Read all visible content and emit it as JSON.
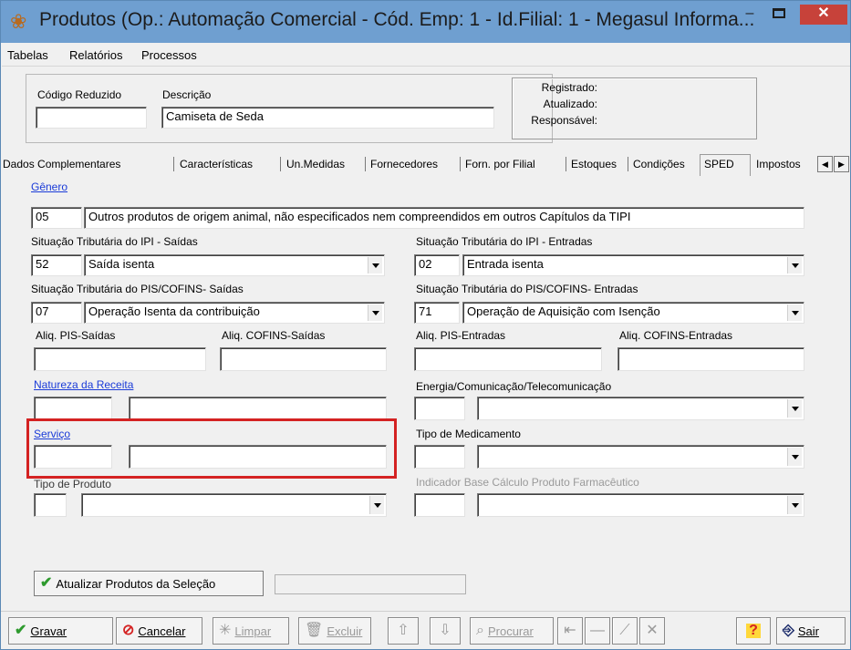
{
  "window": {
    "title": "Produtos (Op.: Automação Comercial - Cód. Emp: 1 - Id.Filial: 1 - Megasul Informa...",
    "minimize": "–",
    "close": "✕"
  },
  "menu": [
    "Tabelas",
    "Relatórios",
    "Processos"
  ],
  "header": {
    "codigo_label": "Código Reduzido",
    "codigo_value": "",
    "descricao_label": "Descrição",
    "descricao_value": "Camiseta de Seda",
    "registrado": "Registrado:",
    "atualizado": "Atualizado:",
    "responsavel": "Responsável:"
  },
  "tabs": [
    "Dados Complementares",
    "Características",
    "Un.Medidas",
    "Fornecedores",
    "Forn. por Filial",
    "Estoques",
    "Condições",
    "SPED",
    "Impostos"
  ],
  "active_tab": "SPED",
  "sped": {
    "genero_label": "Gênero",
    "genero_code": "05",
    "genero_desc": "Outros produtos de origem animal, não especificados nem compreendidos em outros Capítulos da TIPI",
    "ipi_saidas_label": "Situação Tributária do IPI - Saídas",
    "ipi_saidas_code": "52",
    "ipi_saidas_value": "Saída isenta",
    "ipi_entradas_label": "Situação Tributária do IPI - Entradas",
    "ipi_entradas_code": "02",
    "ipi_entradas_value": "Entrada isenta",
    "pis_saidas_label": "Situação Tributária do PIS/COFINS- Saídas",
    "pis_saidas_code": "07",
    "pis_saidas_value": "Operação Isenta da contribuição",
    "pis_entradas_label": "Situação Tributária do PIS/COFINS- Entradas",
    "pis_entradas_code": "71",
    "pis_entradas_value": "Operação de Aquisição com Isenção",
    "aliq_pis_saidas": "Aliq. PIS-Saídas",
    "aliq_cofins_saidas": "Aliq. COFINS-Saídas",
    "aliq_pis_entradas": "Aliq. PIS-Entradas",
    "aliq_cofins_entradas": "Aliq. COFINS-Entradas",
    "natureza_label": "Natureza da Receita",
    "energia_label": "Energia/Comunicação/Telecomunicação",
    "servico_label": "Serviço",
    "medicamento_label": "Tipo de Medicamento",
    "tipo_produto_label": "Tipo de Produto",
    "indicador_label": "Indicador Base Cálculo Produto Farmacêutico"
  },
  "atualizar_button": "Atualizar Produtos da Seleção",
  "toolbar": {
    "gravar": "Gravar",
    "cancelar": "Cancelar",
    "limpar": "Limpar",
    "excluir": "Excluir",
    "procurar": "Procurar",
    "sair": "Sair"
  },
  "colors": {
    "titlebar": "#6f9fd0",
    "highlight": "#d42222",
    "link": "#1a3bd8"
  }
}
